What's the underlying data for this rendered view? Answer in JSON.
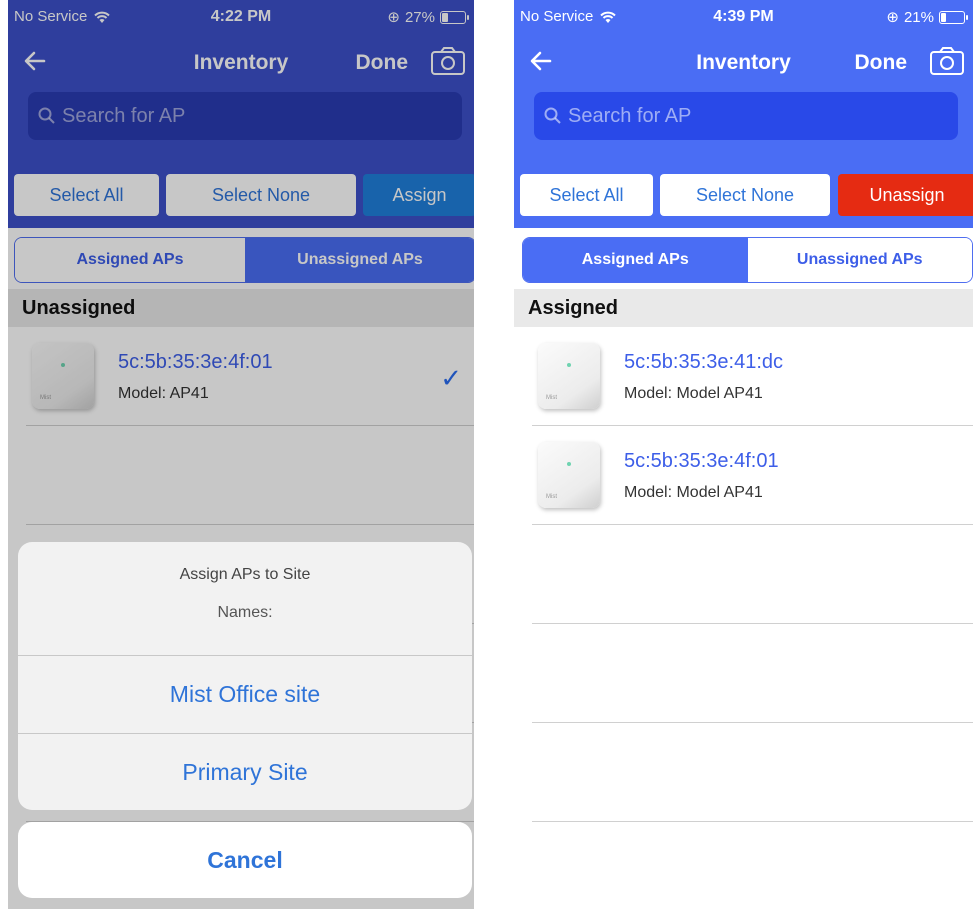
{
  "colors": {
    "left_header": "#3d50c9",
    "right_header": "#4a6df4",
    "left_search": "#2a3bb3",
    "right_search": "#2949e8",
    "assign_btn": "#1f7fdc",
    "unassign_btn": "#e52b12",
    "link_blue": "#3d5ee8"
  },
  "left": {
    "status": {
      "carrier": "No Service",
      "time": "4:22 PM",
      "battery": "27%",
      "battery_level": 0.27
    },
    "nav": {
      "title": "Inventory",
      "done": "Done"
    },
    "search": {
      "placeholder": "Search for AP"
    },
    "toolbar": {
      "select_all": "Select All",
      "select_none": "Select None",
      "action": "Assign"
    },
    "tabs": {
      "assigned": "Assigned APs",
      "unassigned": "Unassigned APs",
      "active": "unassigned"
    },
    "section_header": "Unassigned",
    "rows": [
      {
        "mac": "5c:5b:35:3e:4f:01",
        "model": "Model: AP41",
        "selected": true
      }
    ],
    "sheet": {
      "title": "Assign APs to Site",
      "names_label": "Names:",
      "options": [
        "Mist Office site",
        "Primary Site"
      ],
      "cancel": "Cancel"
    }
  },
  "right": {
    "status": {
      "carrier": "No Service",
      "time": "4:39 PM",
      "battery": "21%",
      "battery_level": 0.21
    },
    "nav": {
      "title": "Inventory",
      "done": "Done"
    },
    "search": {
      "placeholder": "Search for AP"
    },
    "toolbar": {
      "select_all": "Select All",
      "select_none": "Select None",
      "action": "Unassign"
    },
    "tabs": {
      "assigned": "Assigned APs",
      "unassigned": "Unassigned APs",
      "active": "assigned"
    },
    "section_header": "Assigned",
    "rows": [
      {
        "mac": "5c:5b:35:3e:41:dc",
        "model": "Model: Model AP41"
      },
      {
        "mac": "5c:5b:35:3e:4f:01",
        "model": "Model: Model AP41"
      }
    ]
  }
}
